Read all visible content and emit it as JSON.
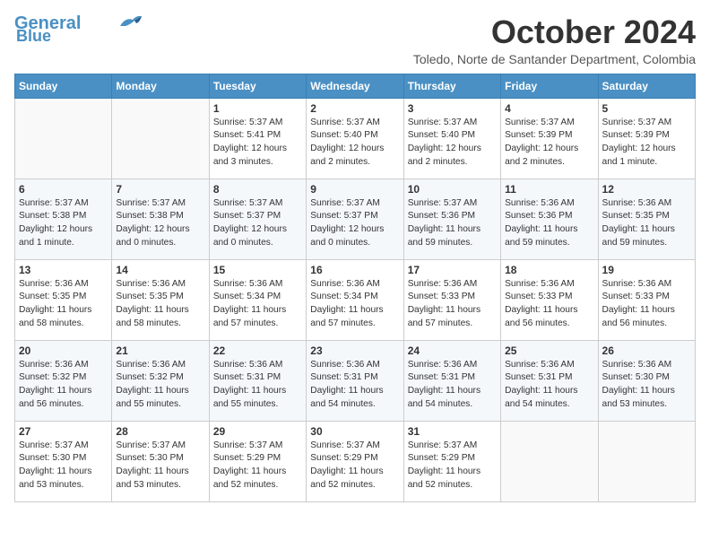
{
  "logo": {
    "line1": "General",
    "line2": "Blue"
  },
  "title": "October 2024",
  "location": "Toledo, Norte de Santander Department, Colombia",
  "weekdays": [
    "Sunday",
    "Monday",
    "Tuesday",
    "Wednesday",
    "Thursday",
    "Friday",
    "Saturday"
  ],
  "weeks": [
    [
      {
        "day": "",
        "info": ""
      },
      {
        "day": "",
        "info": ""
      },
      {
        "day": "1",
        "info": "Sunrise: 5:37 AM\nSunset: 5:41 PM\nDaylight: 12 hours\nand 3 minutes."
      },
      {
        "day": "2",
        "info": "Sunrise: 5:37 AM\nSunset: 5:40 PM\nDaylight: 12 hours\nand 2 minutes."
      },
      {
        "day": "3",
        "info": "Sunrise: 5:37 AM\nSunset: 5:40 PM\nDaylight: 12 hours\nand 2 minutes."
      },
      {
        "day": "4",
        "info": "Sunrise: 5:37 AM\nSunset: 5:39 PM\nDaylight: 12 hours\nand 2 minutes."
      },
      {
        "day": "5",
        "info": "Sunrise: 5:37 AM\nSunset: 5:39 PM\nDaylight: 12 hours\nand 1 minute."
      }
    ],
    [
      {
        "day": "6",
        "info": "Sunrise: 5:37 AM\nSunset: 5:38 PM\nDaylight: 12 hours\nand 1 minute."
      },
      {
        "day": "7",
        "info": "Sunrise: 5:37 AM\nSunset: 5:38 PM\nDaylight: 12 hours\nand 0 minutes."
      },
      {
        "day": "8",
        "info": "Sunrise: 5:37 AM\nSunset: 5:37 PM\nDaylight: 12 hours\nand 0 minutes."
      },
      {
        "day": "9",
        "info": "Sunrise: 5:37 AM\nSunset: 5:37 PM\nDaylight: 12 hours\nand 0 minutes."
      },
      {
        "day": "10",
        "info": "Sunrise: 5:37 AM\nSunset: 5:36 PM\nDaylight: 11 hours\nand 59 minutes."
      },
      {
        "day": "11",
        "info": "Sunrise: 5:36 AM\nSunset: 5:36 PM\nDaylight: 11 hours\nand 59 minutes."
      },
      {
        "day": "12",
        "info": "Sunrise: 5:36 AM\nSunset: 5:35 PM\nDaylight: 11 hours\nand 59 minutes."
      }
    ],
    [
      {
        "day": "13",
        "info": "Sunrise: 5:36 AM\nSunset: 5:35 PM\nDaylight: 11 hours\nand 58 minutes."
      },
      {
        "day": "14",
        "info": "Sunrise: 5:36 AM\nSunset: 5:35 PM\nDaylight: 11 hours\nand 58 minutes."
      },
      {
        "day": "15",
        "info": "Sunrise: 5:36 AM\nSunset: 5:34 PM\nDaylight: 11 hours\nand 57 minutes."
      },
      {
        "day": "16",
        "info": "Sunrise: 5:36 AM\nSunset: 5:34 PM\nDaylight: 11 hours\nand 57 minutes."
      },
      {
        "day": "17",
        "info": "Sunrise: 5:36 AM\nSunset: 5:33 PM\nDaylight: 11 hours\nand 57 minutes."
      },
      {
        "day": "18",
        "info": "Sunrise: 5:36 AM\nSunset: 5:33 PM\nDaylight: 11 hours\nand 56 minutes."
      },
      {
        "day": "19",
        "info": "Sunrise: 5:36 AM\nSunset: 5:33 PM\nDaylight: 11 hours\nand 56 minutes."
      }
    ],
    [
      {
        "day": "20",
        "info": "Sunrise: 5:36 AM\nSunset: 5:32 PM\nDaylight: 11 hours\nand 56 minutes."
      },
      {
        "day": "21",
        "info": "Sunrise: 5:36 AM\nSunset: 5:32 PM\nDaylight: 11 hours\nand 55 minutes."
      },
      {
        "day": "22",
        "info": "Sunrise: 5:36 AM\nSunset: 5:31 PM\nDaylight: 11 hours\nand 55 minutes."
      },
      {
        "day": "23",
        "info": "Sunrise: 5:36 AM\nSunset: 5:31 PM\nDaylight: 11 hours\nand 54 minutes."
      },
      {
        "day": "24",
        "info": "Sunrise: 5:36 AM\nSunset: 5:31 PM\nDaylight: 11 hours\nand 54 minutes."
      },
      {
        "day": "25",
        "info": "Sunrise: 5:36 AM\nSunset: 5:31 PM\nDaylight: 11 hours\nand 54 minutes."
      },
      {
        "day": "26",
        "info": "Sunrise: 5:36 AM\nSunset: 5:30 PM\nDaylight: 11 hours\nand 53 minutes."
      }
    ],
    [
      {
        "day": "27",
        "info": "Sunrise: 5:37 AM\nSunset: 5:30 PM\nDaylight: 11 hours\nand 53 minutes."
      },
      {
        "day": "28",
        "info": "Sunrise: 5:37 AM\nSunset: 5:30 PM\nDaylight: 11 hours\nand 53 minutes."
      },
      {
        "day": "29",
        "info": "Sunrise: 5:37 AM\nSunset: 5:29 PM\nDaylight: 11 hours\nand 52 minutes."
      },
      {
        "day": "30",
        "info": "Sunrise: 5:37 AM\nSunset: 5:29 PM\nDaylight: 11 hours\nand 52 minutes."
      },
      {
        "day": "31",
        "info": "Sunrise: 5:37 AM\nSunset: 5:29 PM\nDaylight: 11 hours\nand 52 minutes."
      },
      {
        "day": "",
        "info": ""
      },
      {
        "day": "",
        "info": ""
      }
    ]
  ]
}
